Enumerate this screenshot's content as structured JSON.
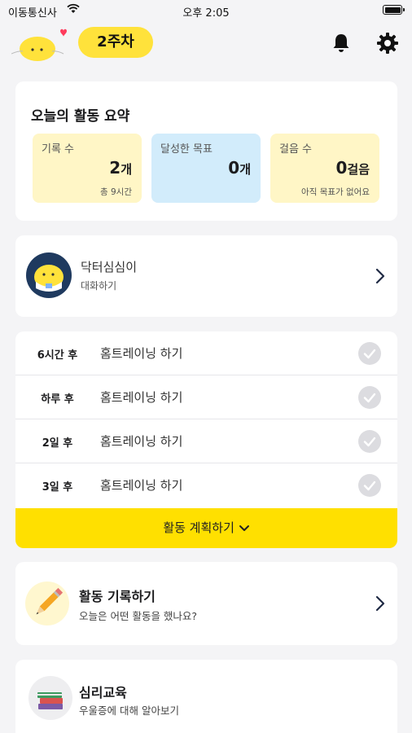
{
  "status_bar": {
    "carrier": "이동통신사",
    "time": "오후 2:05"
  },
  "header": {
    "week_badge": "2주차"
  },
  "summary": {
    "title": "오늘의 활동 요약",
    "stats": [
      {
        "label": "기록 수",
        "value": "2",
        "unit": "개",
        "sub": "총 9시간",
        "color": "#fff6c6"
      },
      {
        "label": "달성한 목표",
        "value": "0",
        "unit": "개",
        "sub": "",
        "color": "#d2ecfb"
      },
      {
        "label": "걸음 수",
        "value": "0",
        "unit": "걸음",
        "sub": "아직 목표가 없어요",
        "color": "#fff6c6"
      }
    ]
  },
  "doctor": {
    "name": "닥터심심이",
    "action": "대화하기"
  },
  "schedule": {
    "items": [
      {
        "when": "6시간 후",
        "task": "홈트레이닝 하기"
      },
      {
        "when": "하루 후",
        "task": "홈트레이닝 하기"
      },
      {
        "when": "2일 후",
        "task": "홈트레이닝 하기"
      },
      {
        "when": "3일 후",
        "task": "홈트레이닝 하기"
      }
    ],
    "plan_button": "활동 계획하기"
  },
  "record": {
    "title": "활동 기록하기",
    "subtitle": "오늘은 어떤 활동을 했나요?"
  },
  "education": {
    "title": "심리교육",
    "subtitle": "우울증에 대해 알아보기"
  },
  "colors": {
    "accent": "#ffe000",
    "background": "#f4f4f6"
  }
}
